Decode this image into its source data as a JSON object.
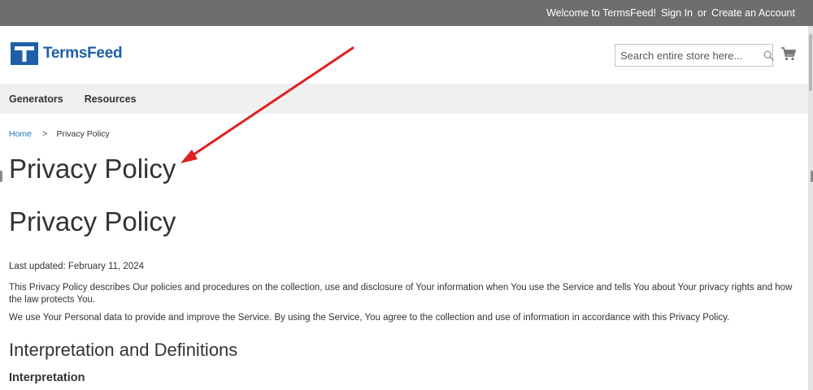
{
  "topbar": {
    "welcome": "Welcome to TermsFeed!",
    "sign_in": "Sign In",
    "or": "or",
    "create_account": "Create an Account"
  },
  "header": {
    "brand": "TermsFeed",
    "search_placeholder": "Search entire store here...",
    "icons": {
      "logo": "termsfeed-logo-icon",
      "search": "search-icon",
      "cart": "cart-icon"
    }
  },
  "nav": {
    "items": [
      "Generators",
      "Resources"
    ]
  },
  "breadcrumb": {
    "home": "Home",
    "separator": ">",
    "current": "Privacy Policy"
  },
  "page": {
    "title": "Privacy Policy",
    "doc_title": "Privacy Policy",
    "last_updated": "Last updated: February 11, 2024",
    "paragraphs": [
      "This Privacy Policy describes Our policies and procedures on the collection, use and disclosure of Your information when You use the Service and tells You about Your privacy rights and how the law protects You.",
      "We use Your Personal data to provide and improve the Service. By using the Service, You agree to the collection and use of information in accordance with this Privacy Policy."
    ],
    "section_heading": "Interpretation and Definitions",
    "subsection_heading": "Interpretation"
  },
  "colors": {
    "topbar": "#6e6e6e",
    "brand_blue": "#1f5fa8",
    "link_blue": "#1979c3",
    "nav_bg": "#f0f0f0",
    "annotation_arrow": "#e02020"
  }
}
